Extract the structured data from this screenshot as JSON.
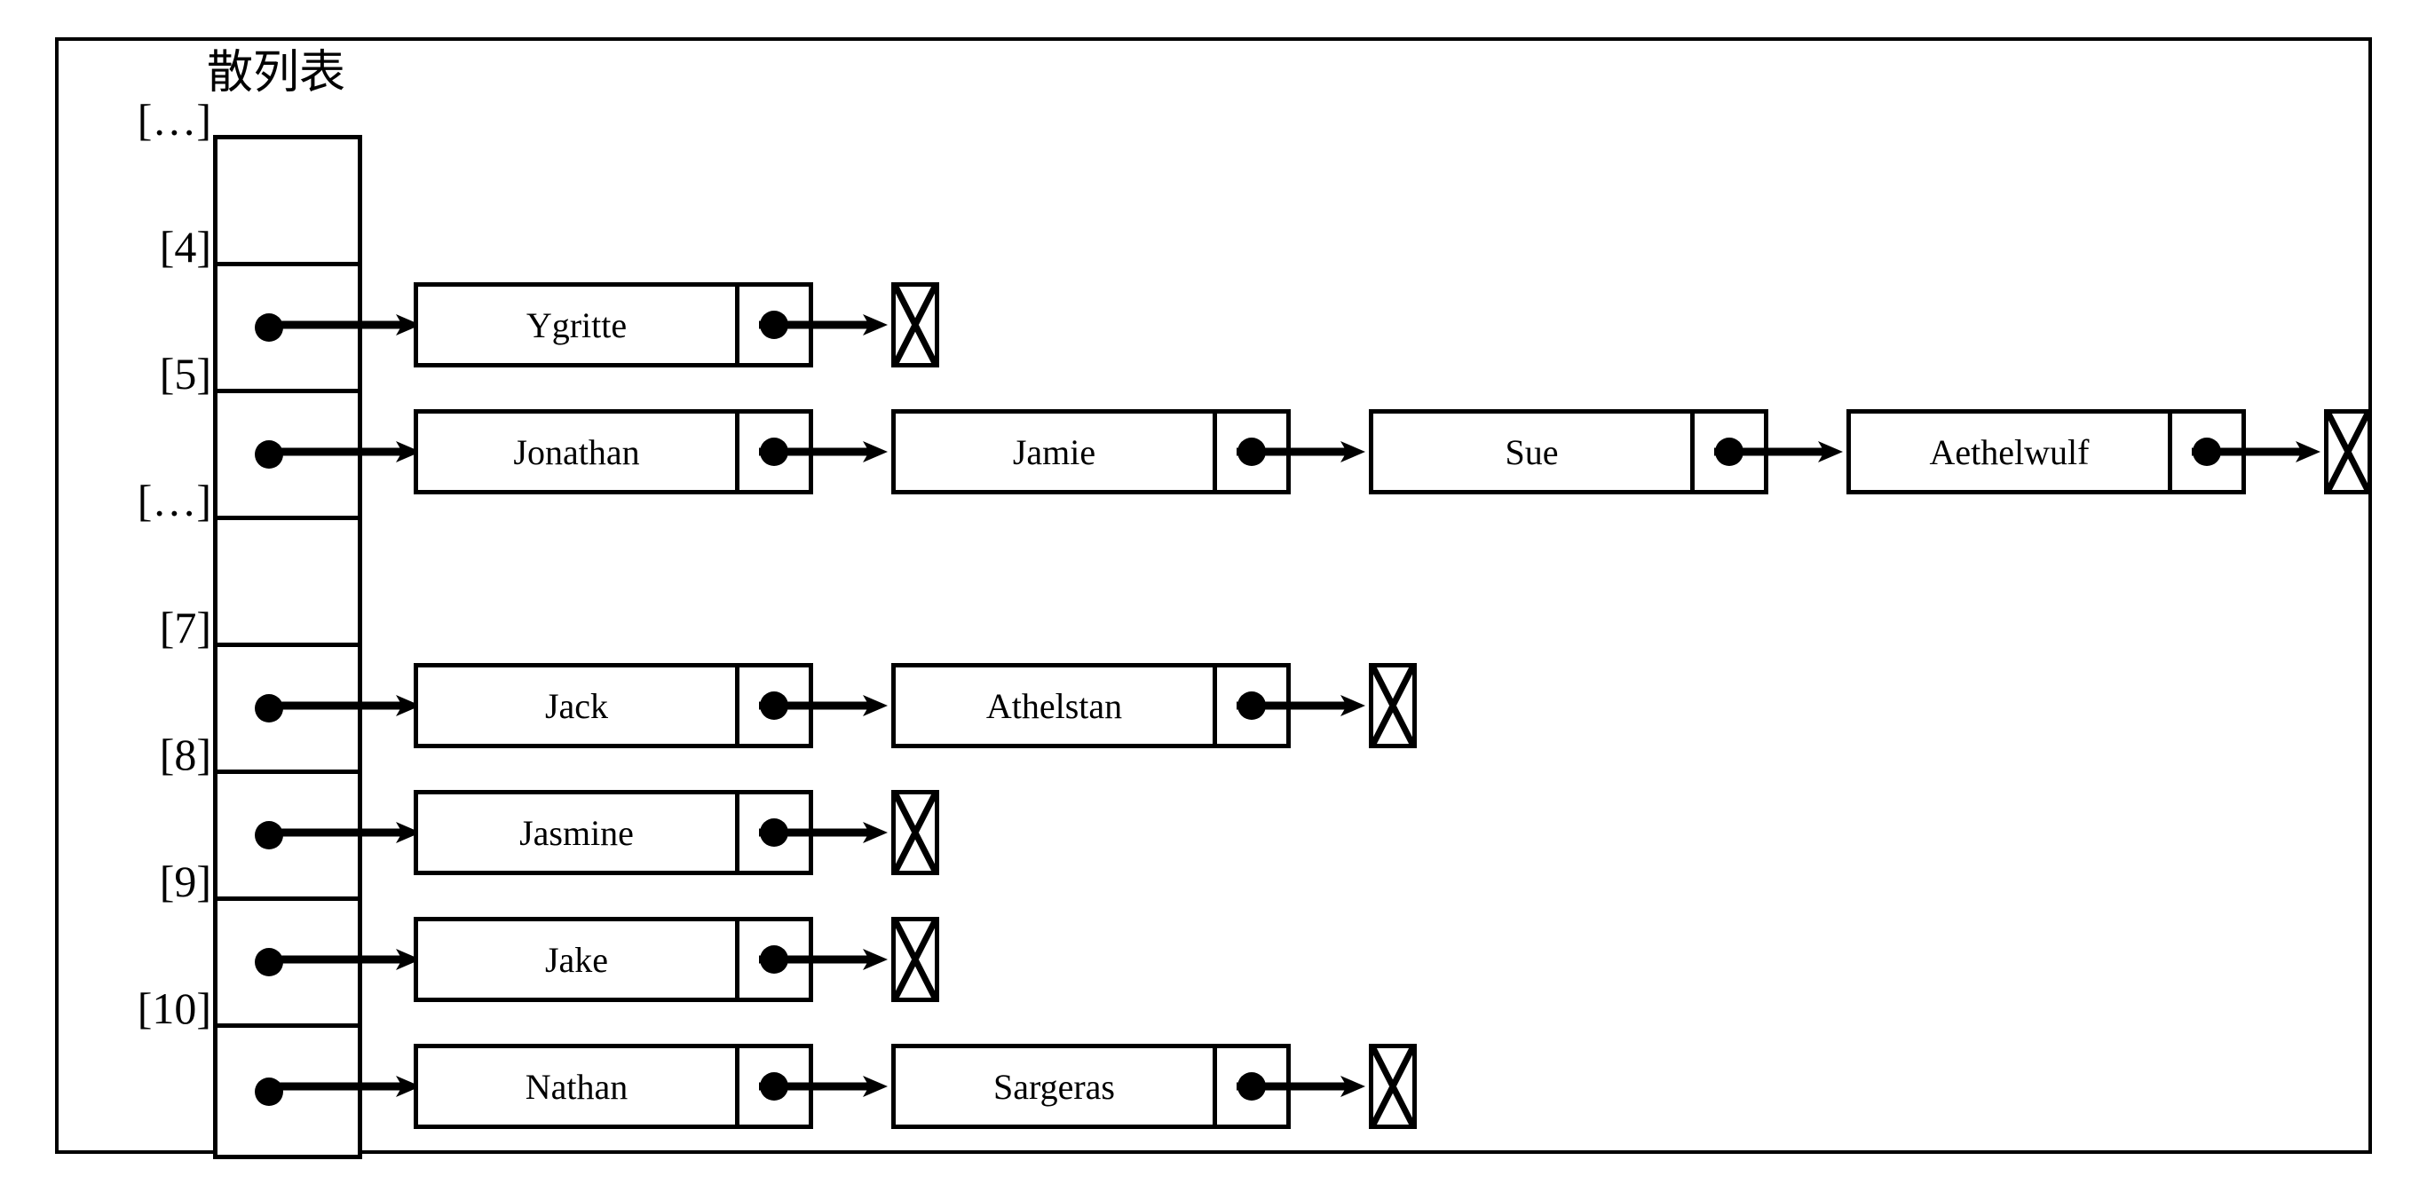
{
  "diagram": {
    "title": "散列表",
    "frame_color": "#000000",
    "background": "#ffffff"
  },
  "index_labels": [
    {
      "label": "[…]"
    },
    {
      "label": "[4]"
    },
    {
      "label": "[5]"
    },
    {
      "label": "[…]"
    },
    {
      "label": "[7]"
    },
    {
      "label": "[8]"
    },
    {
      "label": "[9]"
    },
    {
      "label": "[10]"
    }
  ],
  "buckets": [
    {
      "index": "[…]",
      "occupied": false,
      "chain": []
    },
    {
      "index": "[4]",
      "occupied": true,
      "chain": [
        {
          "name": "Ygritte"
        }
      ]
    },
    {
      "index": "[5]",
      "occupied": true,
      "chain": [
        {
          "name": "Jonathan"
        },
        {
          "name": "Jamie"
        },
        {
          "name": "Sue"
        },
        {
          "name": "Aethelwulf"
        }
      ]
    },
    {
      "index": "[…]",
      "occupied": false,
      "chain": []
    },
    {
      "index": "[7]",
      "occupied": true,
      "chain": [
        {
          "name": "Jack"
        },
        {
          "name": "Athelstan"
        }
      ]
    },
    {
      "index": "[8]",
      "occupied": true,
      "chain": [
        {
          "name": "Jasmine"
        }
      ]
    },
    {
      "index": "[9]",
      "occupied": true,
      "chain": [
        {
          "name": "Jake"
        }
      ]
    },
    {
      "index": "[10]",
      "occupied": true,
      "chain": [
        {
          "name": "Nathan"
        },
        {
          "name": "Sargeras"
        }
      ]
    }
  ],
  "nodes": {
    "r4_n0": "Ygritte",
    "r5_n0": "Jonathan",
    "r5_n1": "Jamie",
    "r5_n2": "Sue",
    "r5_n3": "Aethelwulf",
    "r7_n0": "Jack",
    "r7_n1": "Athelstan",
    "r8_n0": "Jasmine",
    "r9_n0": "Jake",
    "r10_n0": "Nathan",
    "r10_n1": "Sargeras"
  },
  "icons": {
    "pointer_dot": "filled-circle",
    "null_marker": "crossed-box",
    "link": "arrow-right"
  }
}
